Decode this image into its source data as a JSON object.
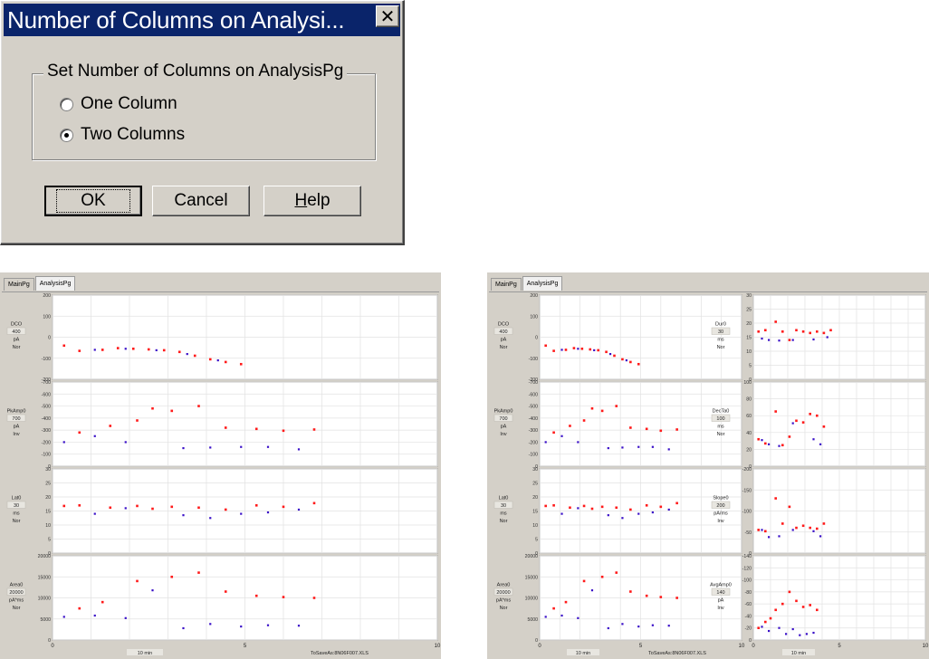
{
  "dialog": {
    "title": "Number of Columns on Analysi...",
    "close_glyph": "✕",
    "group_label": "Set Number of Columns on AnalysisPg",
    "options": [
      {
        "label": "One Column",
        "selected": false
      },
      {
        "label": "Two Columns",
        "selected": true
      }
    ],
    "buttons": {
      "ok": "OK",
      "cancel": "Cancel",
      "help_prefix": "",
      "help_mnemonic": "H",
      "help_rest": "elp"
    }
  },
  "colors": {
    "point_red": "#ff1a1a",
    "point_blue": "#3a10c8",
    "title_bar": "#0a246a"
  },
  "left_window": {
    "tabs": [
      "MainPg",
      "AnalysisPg"
    ],
    "active_tab": "AnalysisPg",
    "footer_left": "10 min",
    "footer_right": "ToSaveAs:8N06F007.XLS",
    "x_ticks": [
      "0",
      "5",
      "10"
    ],
    "rows": [
      {
        "label": [
          "DCO",
          "400",
          "pA",
          "Nor"
        ],
        "y_ticks": [
          "200",
          "100",
          "0",
          "-100",
          "-200"
        ],
        "ymin": -200,
        "ymax": 200,
        "red": [
          [
            0.3,
            -40
          ],
          [
            0.7,
            -65
          ],
          [
            1.3,
            -60
          ],
          [
            1.7,
            -52
          ],
          [
            2.1,
            -55
          ],
          [
            2.5,
            -58
          ],
          [
            2.9,
            -62
          ],
          [
            3.3,
            -70
          ],
          [
            3.7,
            -88
          ],
          [
            4.1,
            -105
          ],
          [
            4.5,
            -118
          ],
          [
            4.9,
            -128
          ]
        ],
        "blue": [
          [
            1.1,
            -60
          ],
          [
            1.9,
            -55
          ],
          [
            2.7,
            -62
          ],
          [
            3.5,
            -80
          ],
          [
            4.3,
            -110
          ]
        ]
      },
      {
        "label": [
          "PkAmp0",
          "700",
          "pA",
          "Inv"
        ],
        "y_ticks": [
          "-700",
          "-600",
          "-500",
          "-400",
          "-300",
          "-200",
          "-100",
          "0"
        ],
        "ymin": 0,
        "ymax": -700,
        "invert": true,
        "red": [
          [
            0.7,
            -280
          ],
          [
            1.5,
            -335
          ],
          [
            2.2,
            -380
          ],
          [
            2.6,
            -480
          ],
          [
            3.1,
            -460
          ],
          [
            3.8,
            -500
          ],
          [
            4.5,
            -320
          ],
          [
            5.3,
            -310
          ],
          [
            6.0,
            -295
          ],
          [
            6.8,
            -305
          ]
        ],
        "blue": [
          [
            0.3,
            -200
          ],
          [
            1.1,
            -250
          ],
          [
            1.9,
            -200
          ],
          [
            3.4,
            -150
          ],
          [
            4.1,
            -155
          ],
          [
            4.9,
            -160
          ],
          [
            5.6,
            -160
          ],
          [
            6.4,
            -140
          ]
        ]
      },
      {
        "label": [
          "Lat0",
          "30",
          "ms",
          "Nor"
        ],
        "y_ticks": [
          "30",
          "25",
          "20",
          "15",
          "10",
          "5",
          "0"
        ],
        "ymin": 0,
        "ymax": 30,
        "red": [
          [
            0.3,
            16.8
          ],
          [
            0.7,
            17
          ],
          [
            1.5,
            16.2
          ],
          [
            2.2,
            16.8
          ],
          [
            2.6,
            15.8
          ],
          [
            3.1,
            16.5
          ],
          [
            3.8,
            16.2
          ],
          [
            4.5,
            15.5
          ],
          [
            5.3,
            17
          ],
          [
            6.0,
            16.5
          ],
          [
            6.8,
            17.8
          ]
        ],
        "blue": [
          [
            1.1,
            14
          ],
          [
            1.9,
            16
          ],
          [
            3.4,
            13.5
          ],
          [
            4.1,
            12.5
          ],
          [
            4.9,
            14
          ],
          [
            5.6,
            14.5
          ],
          [
            6.4,
            15.5
          ]
        ]
      },
      {
        "label": [
          "Area0",
          "20000",
          "pA*ms",
          "Nor"
        ],
        "y_ticks": [
          "20000",
          "15000",
          "10000",
          "5000",
          "0"
        ],
        "ymin": 0,
        "ymax": 20000,
        "red": [
          [
            0.7,
            7500
          ],
          [
            1.3,
            9000
          ],
          [
            2.2,
            14000
          ],
          [
            3.1,
            15000
          ],
          [
            3.8,
            16000
          ],
          [
            4.5,
            11500
          ],
          [
            5.3,
            10500
          ],
          [
            6.0,
            10200
          ],
          [
            6.8,
            10000
          ]
        ],
        "blue": [
          [
            0.3,
            5500
          ],
          [
            1.1,
            5800
          ],
          [
            1.9,
            5200
          ],
          [
            2.6,
            11800
          ],
          [
            3.4,
            2800
          ],
          [
            4.1,
            3800
          ],
          [
            4.9,
            3200
          ],
          [
            5.6,
            3500
          ],
          [
            6.4,
            3400
          ]
        ]
      }
    ]
  },
  "right_window": {
    "tabs": [
      "MainPg",
      "AnalysisPg"
    ],
    "active_tab": "AnalysisPg",
    "footer_left": "10 min",
    "footer_left2": "10 min",
    "footer_right": "ToSaveAs:8N06F007.XLS",
    "x_ticks": [
      "0",
      "5",
      "10"
    ],
    "left_rows": [
      {
        "label": [
          "DCO",
          "400",
          "pA",
          "Nor"
        ],
        "y_ticks": [
          "200",
          "100",
          "0",
          "-100",
          "-200"
        ],
        "ymin": -200,
        "ymax": 200
      },
      {
        "label": [
          "PkAmp0",
          "700",
          "pA",
          "Inv"
        ],
        "y_ticks": [
          "-700",
          "-600",
          "-500",
          "-400",
          "-300",
          "-200",
          "-100",
          "0"
        ],
        "ymin": 0,
        "ymax": -700
      },
      {
        "label": [
          "Lat0",
          "30",
          "ms",
          "Nor"
        ],
        "y_ticks": [
          "30",
          "25",
          "20",
          "15",
          "10",
          "5",
          "0"
        ],
        "ymin": 0,
        "ymax": 30
      },
      {
        "label": [
          "Area0",
          "20000",
          "pA*ms",
          "Nor"
        ],
        "y_ticks": [
          "20000",
          "15000",
          "10000",
          "5000",
          "0"
        ],
        "ymin": 0,
        "ymax": 20000
      }
    ],
    "right_rows": [
      {
        "label": [
          "Dur0",
          "30",
          "ms",
          "Nor"
        ],
        "y_ticks": [
          "30",
          "25",
          "20",
          "15",
          "10",
          "5",
          "0"
        ],
        "ymin": 0,
        "ymax": 30,
        "red": [
          [
            0.3,
            17
          ],
          [
            0.7,
            17.5
          ],
          [
            1.3,
            20.5
          ],
          [
            1.7,
            17
          ],
          [
            2.1,
            14
          ],
          [
            2.5,
            17.5
          ],
          [
            2.9,
            17
          ],
          [
            3.3,
            16.5
          ],
          [
            3.7,
            17
          ],
          [
            4.1,
            16.5
          ],
          [
            4.5,
            17.5
          ]
        ],
        "blue": [
          [
            0.5,
            14.5
          ],
          [
            0.9,
            14
          ],
          [
            1.5,
            13.8
          ],
          [
            2.3,
            14
          ],
          [
            3.5,
            14.2
          ],
          [
            4.3,
            15
          ]
        ]
      },
      {
        "label": [
          "DecTa0",
          "100",
          "ms",
          "Nor"
        ],
        "y_ticks": [
          "100",
          "80",
          "60",
          "40",
          "20",
          "0"
        ],
        "ymin": 0,
        "ymax": 100,
        "red": [
          [
            0.3,
            32
          ],
          [
            0.7,
            27
          ],
          [
            1.3,
            65
          ],
          [
            1.7,
            25
          ],
          [
            2.1,
            35
          ],
          [
            2.5,
            54
          ],
          [
            2.9,
            52
          ],
          [
            3.3,
            62
          ],
          [
            3.7,
            60
          ],
          [
            4.1,
            47
          ]
        ],
        "blue": [
          [
            0.5,
            31
          ],
          [
            0.9,
            26
          ],
          [
            1.5,
            24
          ],
          [
            2.3,
            51
          ],
          [
            3.5,
            32
          ],
          [
            3.9,
            26
          ]
        ]
      },
      {
        "label": [
          "Slope0",
          "200",
          "pA/ms",
          "Inv"
        ],
        "y_ticks": [
          "-200",
          "-150",
          "-100",
          "-50",
          "0"
        ],
        "ymin": 0,
        "ymax": -200,
        "red": [
          [
            0.3,
            -55
          ],
          [
            0.7,
            -52
          ],
          [
            1.3,
            -130
          ],
          [
            1.7,
            -70
          ],
          [
            2.1,
            -110
          ],
          [
            2.5,
            -60
          ],
          [
            2.9,
            -65
          ],
          [
            3.3,
            -60
          ],
          [
            3.7,
            -58
          ],
          [
            4.1,
            -70
          ]
        ],
        "blue": [
          [
            0.5,
            -55
          ],
          [
            0.9,
            -38
          ],
          [
            1.5,
            -40
          ],
          [
            2.3,
            -55
          ],
          [
            3.5,
            -52
          ],
          [
            3.9,
            -40
          ]
        ]
      },
      {
        "label": [
          "AvgAmp0",
          "140",
          "pA",
          "Inv"
        ],
        "y_ticks": [
          "-140",
          "-120",
          "-100",
          "-80",
          "-60",
          "-40",
          "-20",
          "0"
        ],
        "ymin": 0,
        "ymax": -140,
        "red": [
          [
            0.3,
            -20
          ],
          [
            0.7,
            -30
          ],
          [
            1.0,
            -36
          ],
          [
            1.3,
            -50
          ],
          [
            1.7,
            -60
          ],
          [
            2.1,
            -80
          ],
          [
            2.5,
            -65
          ],
          [
            2.9,
            -55
          ],
          [
            3.3,
            -58
          ],
          [
            3.7,
            -50
          ]
        ],
        "blue": [
          [
            0.5,
            -22
          ],
          [
            0.9,
            -15
          ],
          [
            1.5,
            -20
          ],
          [
            1.9,
            -10
          ],
          [
            2.3,
            -18
          ],
          [
            2.7,
            -8
          ],
          [
            3.1,
            -10
          ],
          [
            3.5,
            -12
          ]
        ]
      }
    ]
  }
}
